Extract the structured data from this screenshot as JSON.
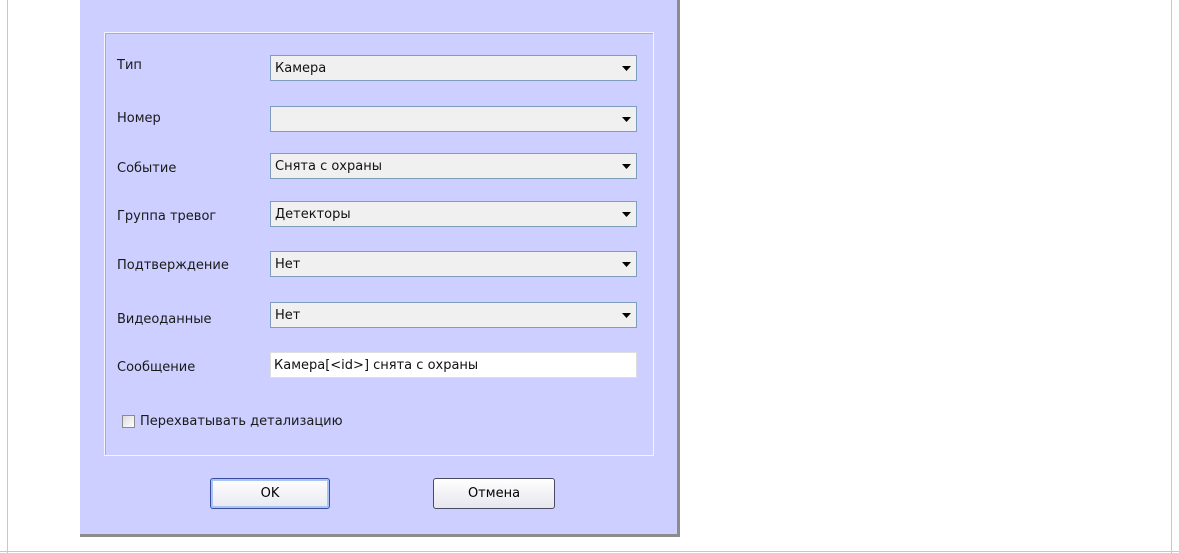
{
  "dialog": {
    "fields": [
      {
        "label": "Тип",
        "value": "Камера",
        "kind": "combo"
      },
      {
        "label": "Номер",
        "value": "",
        "kind": "combo"
      },
      {
        "label": "Событие",
        "value": "Снята с охраны",
        "kind": "combo"
      },
      {
        "label": "Группа тревог",
        "value": "Детекторы",
        "kind": "combo"
      },
      {
        "label": "Подтверждение",
        "value": "Нет",
        "kind": "combo"
      },
      {
        "label": "Видеоданные",
        "value": "Нет",
        "kind": "combo"
      }
    ],
    "message": {
      "label": "Сообщение",
      "value": "Камера[<id>] снята с охраны"
    },
    "intercept_checkbox": {
      "label": "Перехватывать детализацию",
      "checked": false
    },
    "buttons": {
      "ok_label": "OK",
      "cancel_label": "Отмена"
    }
  },
  "colors": {
    "dialog_background": "#cccfff",
    "combo_background": "#f0f0f0",
    "ok_button_border": "#3c4c9c"
  },
  "icons": {
    "combo_arrow": "chevron-down-icon",
    "checkbox": "checkbox-unchecked-icon"
  }
}
